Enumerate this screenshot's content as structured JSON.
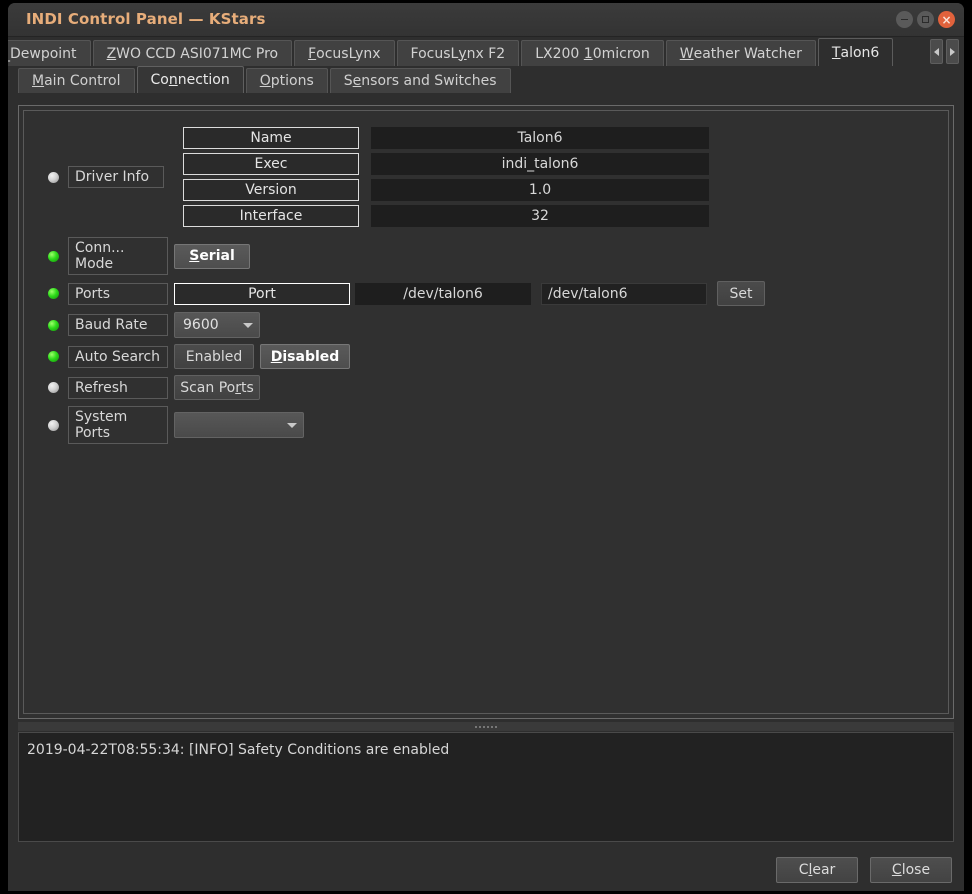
{
  "window": {
    "title": "INDI Control Panel — KStars",
    "controls": {
      "minimize": "minimize-button",
      "maximize": "maximize-button",
      "close": "close-button"
    }
  },
  "device_tabs": {
    "items": [
      {
        "label": "_Dewpoint",
        "mnemonic": "",
        "active": false,
        "clipped": true
      },
      {
        "label": "ZWO CCD ASI071MC Pro",
        "mnemonic": "Z",
        "active": false
      },
      {
        "label": "FocusLynx",
        "mnemonic": "F",
        "active": false
      },
      {
        "label": "FocusLynx F2",
        "mnemonic": "y",
        "active": false
      },
      {
        "label": "LX200 10micron",
        "mnemonic": "1",
        "active": false
      },
      {
        "label": "Weather Watcher",
        "mnemonic": "W",
        "active": false
      },
      {
        "label": "Talon6",
        "mnemonic": "T",
        "active": true
      }
    ],
    "scroll_left": "◀",
    "scroll_right": "▶"
  },
  "property_tabs": {
    "items": [
      {
        "label": "Main Control",
        "mnemonic": "M",
        "active": false
      },
      {
        "label": "Connection",
        "mnemonic": "n",
        "active": true
      },
      {
        "label": "Options",
        "mnemonic": "O",
        "active": false
      },
      {
        "label": "Sensors and Switches",
        "mnemonic": "e",
        "active": false
      }
    ]
  },
  "properties": {
    "driver_info": {
      "label": "Driver Info",
      "led": "idle",
      "rows": [
        {
          "key": "Name",
          "value": "Talon6"
        },
        {
          "key": "Exec",
          "value": "indi_talon6"
        },
        {
          "key": "Version",
          "value": "1.0"
        },
        {
          "key": "Interface",
          "value": "32"
        }
      ]
    },
    "connection_mode": {
      "label_line1": "Conn...",
      "label_line2": "Mode",
      "led": "ok",
      "options": [
        {
          "label": "Serial",
          "mnemonic": "S",
          "selected": true
        }
      ]
    },
    "ports": {
      "label": "Ports",
      "led": "ok",
      "key": "Port",
      "value": "/dev/talon6",
      "edit_value": "/dev/talon6",
      "set_label": "Set"
    },
    "baud_rate": {
      "label": "Baud Rate",
      "led": "ok",
      "value": "9600"
    },
    "auto_search": {
      "label": "Auto Search",
      "led": "ok",
      "options": [
        {
          "label": "Enabled",
          "mnemonic": "",
          "selected": false
        },
        {
          "label": "Disabled",
          "mnemonic": "D",
          "selected": true
        }
      ]
    },
    "refresh": {
      "label": "Refresh",
      "led": "idle",
      "button_label": "Scan Ports",
      "button_mnemonic": "r"
    },
    "system_ports": {
      "label_line1": "System",
      "label_line2": "Ports",
      "led": "idle",
      "value": ""
    }
  },
  "log": {
    "lines": [
      "2019-04-22T08:55:34: [INFO] Safety Conditions are enabled"
    ]
  },
  "footer": {
    "clear_label": "Clear",
    "clear_mnemonic": "l",
    "close_label": "Close",
    "close_mnemonic": "C"
  },
  "colors": {
    "window_bg": "#2e2e2e",
    "title_text": "#e7ad7a",
    "led_ok": "#2ddb1a",
    "led_idle": "#d2d2d2",
    "close_button": "#e1623c",
    "panel_bg": "#303030",
    "log_bg": "#222222"
  }
}
